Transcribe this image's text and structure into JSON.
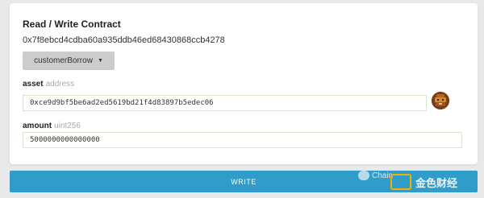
{
  "contract": {
    "title": "Read / Write Contract",
    "address": "0x7f8ebcd4cdba60a935ddb46ed68430868ccb4278"
  },
  "function_select": {
    "selected": "customerBorrow",
    "caret_icon": "chevron-down-icon"
  },
  "inputs": {
    "asset": {
      "name": "asset",
      "type": "address",
      "value": "0xce9d9bf5be6ad2ed5619bd21f4d83897b5edec06"
    },
    "amount": {
      "name": "amount",
      "type": "uint256",
      "value": "5000000000000000"
    }
  },
  "actions": {
    "write_label": "WRITE"
  },
  "watermark": {
    "text1": "Chain",
    "text2": "金色财经"
  },
  "colors": {
    "write_button": "#2f9cc9",
    "select_bg": "#cccccc",
    "input_border": "#d9e6d0",
    "card_bg": "#ffffff",
    "page_bg": "#e9e9e9"
  }
}
